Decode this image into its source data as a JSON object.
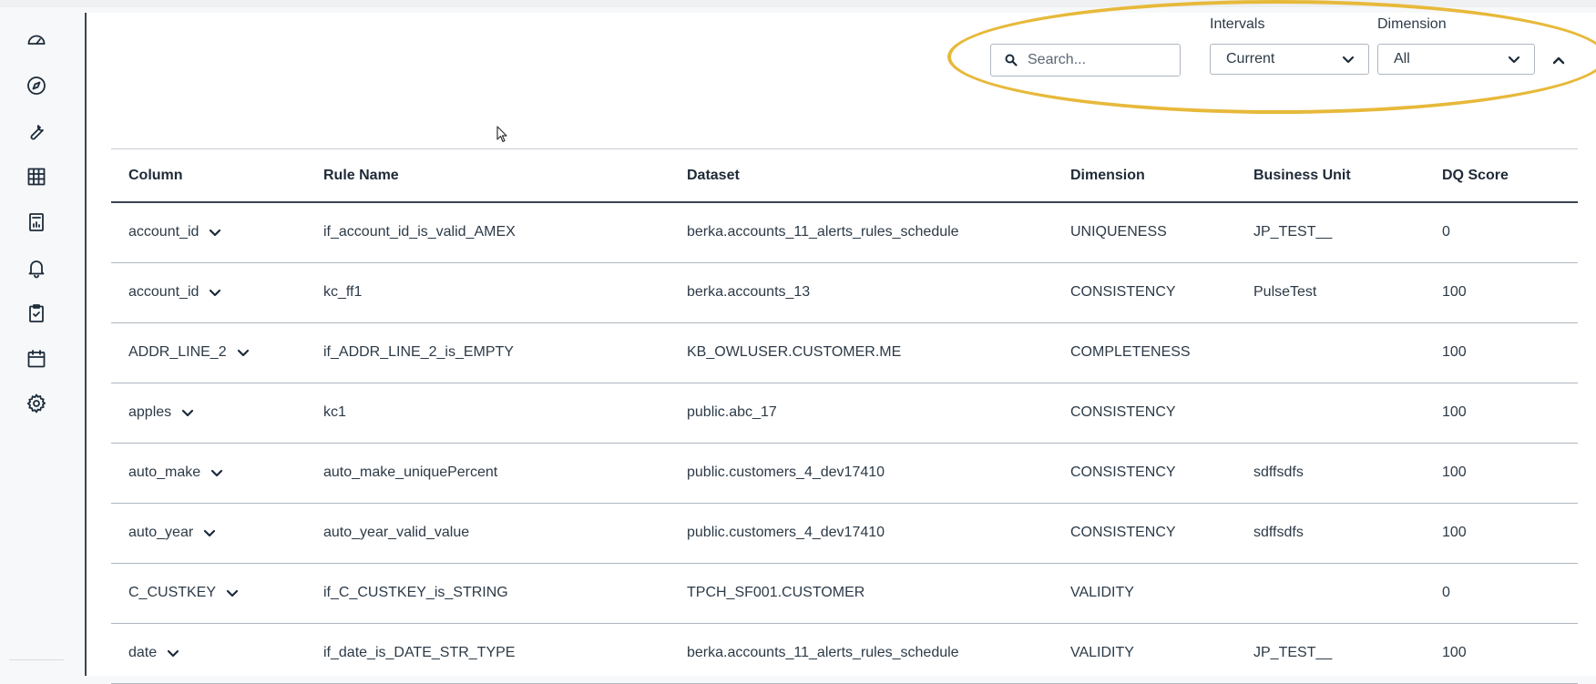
{
  "sidebar": {
    "items": [
      {
        "icon": "dashboard-gauge-icon"
      },
      {
        "icon": "compass-icon"
      },
      {
        "icon": "wrench-icon"
      },
      {
        "icon": "table-grid-icon"
      },
      {
        "icon": "report-document-icon"
      },
      {
        "icon": "bell-icon"
      },
      {
        "icon": "clipboard-check-icon"
      },
      {
        "icon": "calendar-icon"
      },
      {
        "icon": "gear-icon"
      }
    ]
  },
  "toolbar": {
    "search_placeholder": "Search...",
    "intervals_label": "Intervals",
    "intervals_value": "Current",
    "dimension_label": "Dimension",
    "dimension_value": "All"
  },
  "table": {
    "headers": {
      "column": "Column",
      "rule_name": "Rule Name",
      "dataset": "Dataset",
      "dimension": "Dimension",
      "business_unit": "Business Unit",
      "dq_score": "DQ Score"
    },
    "rows": [
      {
        "column": "account_id",
        "rule_name": "if_account_id_is_valid_AMEX",
        "dataset": "berka.accounts_11_alerts_rules_schedule",
        "dimension": "UNIQUENESS",
        "business_unit": "JP_TEST__",
        "dq_score": "0"
      },
      {
        "column": "account_id",
        "rule_name": "kc_ff1",
        "dataset": "berka.accounts_13",
        "dimension": "CONSISTENCY",
        "business_unit": "PulseTest",
        "dq_score": "100"
      },
      {
        "column": "ADDR_LINE_2",
        "rule_name": "if_ADDR_LINE_2_is_EMPTY",
        "dataset": "KB_OWLUSER.CUSTOMER.ME",
        "dimension": "COMPLETENESS",
        "business_unit": "",
        "dq_score": "100"
      },
      {
        "column": "apples",
        "rule_name": "kc1",
        "dataset": "public.abc_17",
        "dimension": "CONSISTENCY",
        "business_unit": "",
        "dq_score": "100"
      },
      {
        "column": "auto_make",
        "rule_name": "auto_make_uniquePercent",
        "dataset": "public.customers_4_dev17410",
        "dimension": "CONSISTENCY",
        "business_unit": "sdffsdfs",
        "dq_score": "100"
      },
      {
        "column": "auto_year",
        "rule_name": "auto_year_valid_value",
        "dataset": "public.customers_4_dev17410",
        "dimension": "CONSISTENCY",
        "business_unit": "sdffsdfs",
        "dq_score": "100"
      },
      {
        "column": "C_CUSTKEY",
        "rule_name": "if_C_CUSTKEY_is_STRING",
        "dataset": "TPCH_SF001.CUSTOMER",
        "dimension": "VALIDITY",
        "business_unit": "",
        "dq_score": "0"
      },
      {
        "column": "date",
        "rule_name": "if_date_is_DATE_STR_TYPE",
        "dataset": "berka.accounts_11_alerts_rules_schedule",
        "dimension": "VALIDITY",
        "business_unit": "JP_TEST__",
        "dq_score": "100"
      }
    ]
  },
  "colors": {
    "highlight": "#e7b93a",
    "divider": "#3a4550"
  }
}
